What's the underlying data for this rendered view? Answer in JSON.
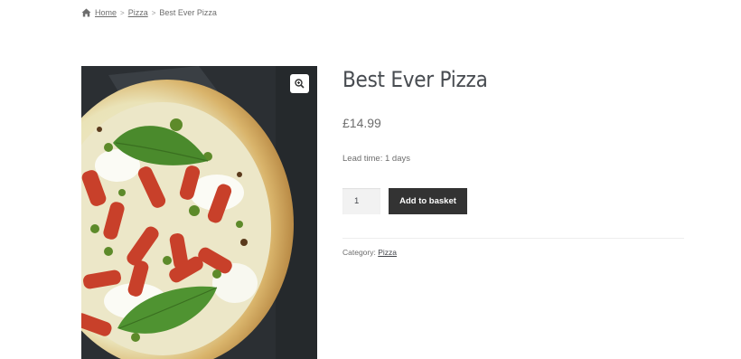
{
  "breadcrumb": {
    "icon": "home-icon",
    "items": [
      "Home",
      "Pizza"
    ],
    "current": "Best Ever Pizza",
    "separator": ">"
  },
  "gallery": {
    "zoom_icon": "zoom-in-icon",
    "image_alt": "Best Ever Pizza"
  },
  "product": {
    "title": "Best Ever Pizza",
    "price": "£14.99",
    "lead_time": "Lead time: 1 days",
    "quantity": "1",
    "add_to_basket_label": "Add to basket",
    "category_label": "Category:",
    "category_value": "Pizza"
  },
  "colors": {
    "button_bg": "#333333",
    "quantity_bg": "#f2f2f2",
    "text": "#43454b",
    "muted_text": "#6d6d6d"
  }
}
